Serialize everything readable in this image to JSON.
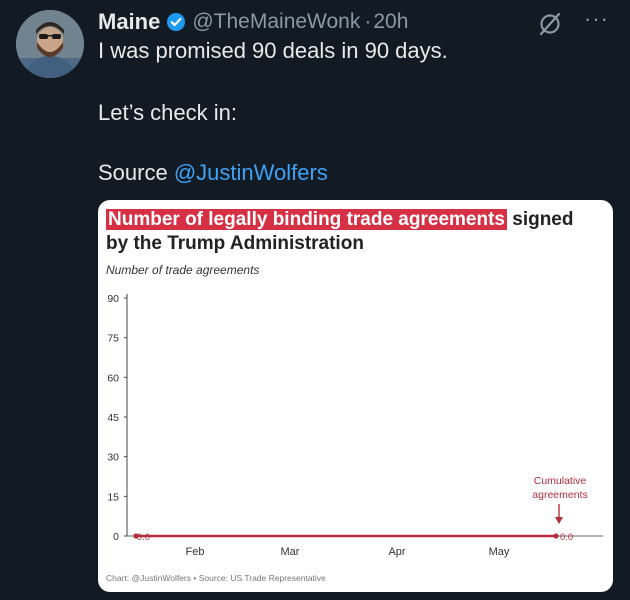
{
  "tweet": {
    "author_name": "Maine",
    "handle": "@TheMaineWonk",
    "separator": "·",
    "time": "20h",
    "lines": {
      "line1": "I was promised 90 deals in 90 days.",
      "line2": "Let’s check in:",
      "source_prefix": "Source",
      "source_mention": "@JustinWolfers"
    },
    "icons": {
      "verified": "verified-badge-icon",
      "grok": "grok-icon",
      "more": "more-options-icon"
    },
    "more_label": "···"
  },
  "chart_card": {
    "title_highlight": "Number of legally binding trade agreements",
    "title_rest_1": "signed",
    "title_rest_2": "by the Trump Administration",
    "subtitle": "Number of trade agreements",
    "footer": "Chart: @JustinWolfers • Source: US Trade Representative",
    "annotation_line1": "Cumulative",
    "annotation_line2": "agreements",
    "start_label": "0.0",
    "end_label": "0.0"
  },
  "chart_data": {
    "type": "line",
    "title": "Number of legally binding trade agreements signed by the Trump Administration",
    "ylabel": "Number of trade agreements",
    "xlabel": "",
    "y_ticks": [
      0,
      15,
      30,
      45,
      60,
      75,
      90
    ],
    "ylim": [
      0,
      90
    ],
    "x_tick_labels": [
      "Feb",
      "Mar",
      "Apr",
      "May"
    ],
    "series": [
      {
        "name": "Cumulative agreements",
        "x": [
          "Jan 20",
          "May 28"
        ],
        "values": [
          0,
          0
        ]
      }
    ],
    "annotations": [
      "Cumulative agreements"
    ],
    "data_labels": [
      "0.0",
      "0.0"
    ],
    "grid": false,
    "colors": {
      "line": "#b52d3f",
      "highlight": "#d63045"
    }
  }
}
